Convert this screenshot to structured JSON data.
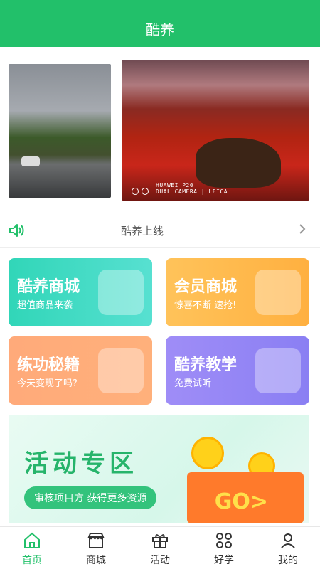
{
  "header": {
    "title": "酷养"
  },
  "banner": {
    "image1_icon": "road-photo",
    "image2_icon": "horse-performance-photo",
    "caption_line1": "HUAWEI P20",
    "caption_line2": "DUAL CAMERA | LEICA"
  },
  "notice": {
    "text": "酷养上线",
    "icon": "speaker-icon"
  },
  "cards": [
    {
      "title": "酷养商城",
      "subtitle": "超值商品来袭"
    },
    {
      "title": "会员商城",
      "subtitle": "惊喜不断 速抢!"
    },
    {
      "title": "练功秘籍",
      "subtitle": "今天变现了吗?"
    },
    {
      "title": "酷养教学",
      "subtitle": "免费试听"
    }
  ],
  "promo": {
    "title": "活动专区",
    "pill": "审核项目方 获得更多资源",
    "go": "GO>"
  },
  "tabs": [
    {
      "label": "首页",
      "icon": "home-icon",
      "active": true
    },
    {
      "label": "商城",
      "icon": "store-icon",
      "active": false
    },
    {
      "label": "活动",
      "icon": "gift-icon",
      "active": false
    },
    {
      "label": "好学",
      "icon": "grid-icon",
      "active": false
    },
    {
      "label": "我的",
      "icon": "user-icon",
      "active": false
    }
  ],
  "colors": {
    "brand": "#22c06a"
  }
}
